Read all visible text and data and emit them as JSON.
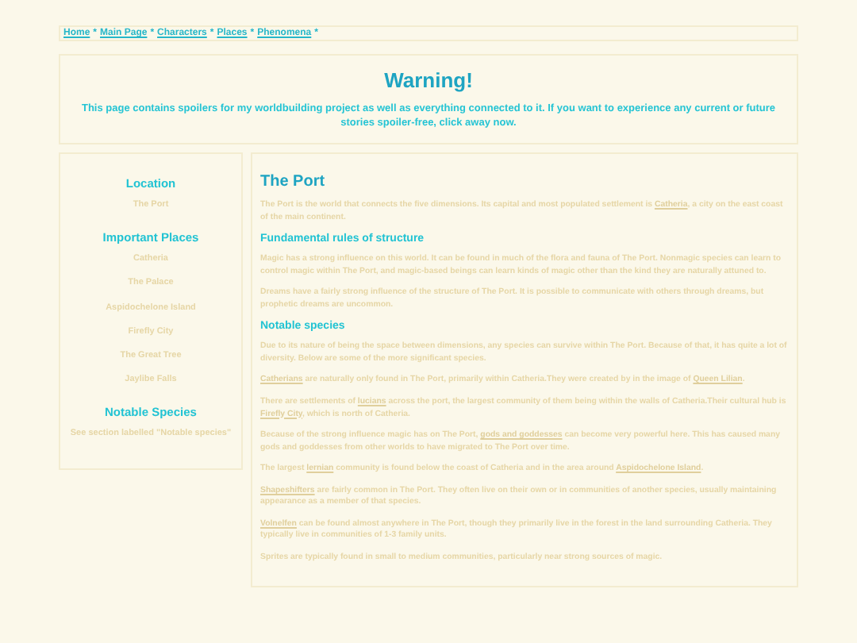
{
  "nav": {
    "links": [
      {
        "text": "Home",
        "separator": "*"
      },
      {
        "text": "Main Page",
        "separator": "*"
      },
      {
        "text": "Characters",
        "separator": "*"
      },
      {
        "text": "Places",
        "separator": "*"
      },
      {
        "text": "Phenomena",
        "separator": "*"
      }
    ]
  },
  "warning": {
    "title": "Warning!",
    "text": "This page contains spoilers for my worldbuilding project as well as everything connected to it. If you want to experience any current or future stories spoiler-free, click away now."
  },
  "sidebar": {
    "sections": [
      {
        "heading": "Location",
        "items": [
          "The Port"
        ]
      },
      {
        "heading": "Important Places",
        "items": [
          "Catheria",
          "The Palace",
          "Aspidochelone Island",
          "Firefly City",
          "The Great Tree",
          "Jaylibe Falls"
        ]
      },
      {
        "heading": "Notable Species",
        "items": [
          "See section labelled \"Notable species\""
        ]
      }
    ]
  },
  "article": {
    "title": "The Port",
    "blocks": [
      {
        "kind": "paragraph",
        "parts": [
          {
            "text": "The Port is the world that connects the five dimensions. Its capital and most populated settlement is ",
            "link": false
          },
          {
            "text": "Catheria",
            "link": true
          },
          {
            "text": ", a city on the east coast of the main continent.",
            "link": false
          }
        ]
      },
      {
        "kind": "heading",
        "text": "Fundamental rules of structure"
      },
      {
        "kind": "paragraph",
        "parts": [
          {
            "text": "Magic has a strong influence on this world. It can be found in much of the flora and fauna of The Port. Nonmagic species can learn to control magic within The Port, and magic-based beings can learn kinds of magic other than the kind they are naturally attuned to.",
            "link": false
          }
        ]
      },
      {
        "kind": "paragraph",
        "parts": [
          {
            "text": "Dreams have a fairly strong influence of the structure of The Port. It is possible to communicate with others through dreams, but prophetic dreams are uncommon.",
            "link": false
          }
        ]
      },
      {
        "kind": "heading",
        "text": "Notable species"
      },
      {
        "kind": "paragraph",
        "parts": [
          {
            "text": "Due to its nature of being the space between dimensions, any species can survive within The Port. Because of that, it has quite a lot of diversity. Below are some of the more significant species.",
            "link": false
          }
        ]
      },
      {
        "kind": "paragraph",
        "parts": [
          {
            "text": "Catherians",
            "link": true
          },
          {
            "text": " are naturally only found in The Port, primarily within Catheria.They were created by in the image of ",
            "link": false
          },
          {
            "text": "Queen Lilian",
            "link": true
          },
          {
            "text": ".",
            "link": false
          }
        ]
      },
      {
        "kind": "paragraph",
        "parts": [
          {
            "text": "There are settlements of ",
            "link": false
          },
          {
            "text": "lucians",
            "link": true
          },
          {
            "text": " across the port, the largest community of them being within the walls of Catheria.Their cultural hub is ",
            "link": false
          },
          {
            "text": "Firefly City",
            "link": true
          },
          {
            "text": ", which is north of Catheria.",
            "link": false
          }
        ]
      },
      {
        "kind": "paragraph",
        "parts": [
          {
            "text": "Because of the strong influence magic has on The Port, ",
            "link": false
          },
          {
            "text": "gods and goddesses",
            "link": true
          },
          {
            "text": " can become very powerful here. This has caused many gods and goddesses from other worlds to have migrated to The Port over time.",
            "link": false
          }
        ]
      },
      {
        "kind": "paragraph",
        "parts": [
          {
            "text": "The largest ",
            "link": false
          },
          {
            "text": "lernian",
            "link": true
          },
          {
            "text": " community is found below the coast of Catheria and in the area around ",
            "link": false
          },
          {
            "text": "Aspidochelone Island",
            "link": true
          },
          {
            "text": ".",
            "link": false
          }
        ]
      },
      {
        "kind": "paragraph",
        "parts": [
          {
            "text": "Shapeshifters",
            "link": true
          },
          {
            "text": " are fairly common in The Port. They often live on their own or in communities of another species, usually maintaining appearance as a member of that species.",
            "link": false
          }
        ]
      },
      {
        "kind": "paragraph",
        "parts": [
          {
            "text": "Volnelfen",
            "link": true
          },
          {
            "text": " can be found almost anywhere in The Port, though they primarily live in the forest in the land surrounding Catheria. They typically live in communities of 1-3 family units.",
            "link": false
          }
        ]
      },
      {
        "kind": "paragraph",
        "parts": [
          {
            "text": "Sprites are typically found in small to medium communities, particularly near strong sources of magic.",
            "link": false
          }
        ]
      }
    ]
  }
}
